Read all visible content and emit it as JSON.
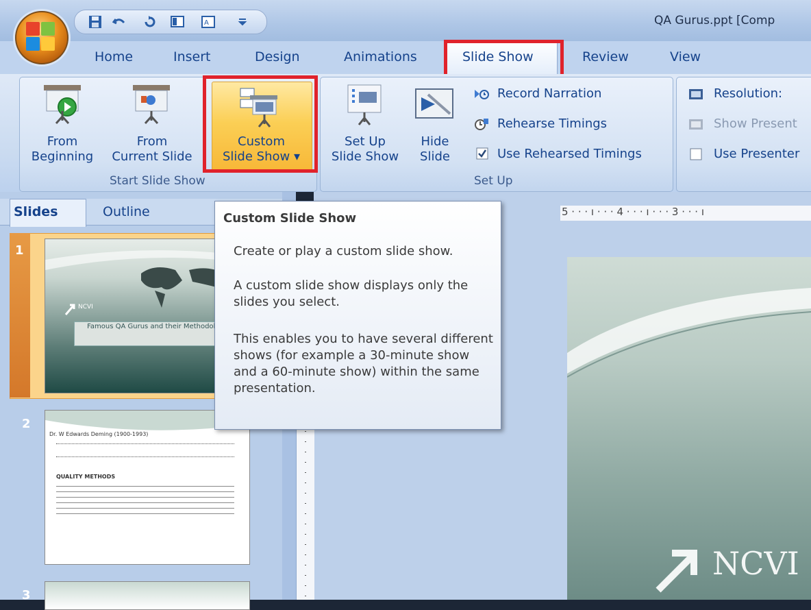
{
  "window": {
    "title": "QA Gurus.ppt [Comp"
  },
  "tabs": [
    {
      "label": "Home"
    },
    {
      "label": "Insert"
    },
    {
      "label": "Design"
    },
    {
      "label": "Animations"
    },
    {
      "label": "Slide Show"
    },
    {
      "label": "Review"
    },
    {
      "label": "View"
    }
  ],
  "ribbon": {
    "start_group": {
      "label": "Start Slide Show",
      "from_beginning": {
        "line1": "From",
        "line2": "Beginning"
      },
      "from_current": {
        "line1": "From",
        "line2": "Current Slide"
      },
      "custom_show": {
        "line1": "Custom",
        "line2": "Slide Show ▾"
      }
    },
    "setup_group": {
      "label": "Set Up",
      "setup_show": {
        "line1": "Set Up",
        "line2": "Slide Show"
      },
      "hide_slide": {
        "line1": "Hide",
        "line2": "Slide"
      },
      "record_narration": "Record Narration",
      "rehearse_timings": "Rehearse Timings",
      "use_rehearsed": "Use Rehearsed Timings"
    },
    "monitors_group": {
      "resolution": "Resolution:",
      "show_presentation_on": "Show Present",
      "use_presenter_view": "Use Presenter"
    }
  },
  "pane": {
    "tabs": [
      "Slides",
      "Outline"
    ],
    "slides": [
      {
        "number": "1",
        "title": "Famous QA Gurus and their Methodologies",
        "logo": "NCVI"
      },
      {
        "number": "2",
        "heading": "Dr. W Edwards Deming (1900-1993)",
        "subheading": "QUALITY METHODS"
      },
      {
        "number": "3"
      }
    ]
  },
  "ruler": {
    "text": "5 · · · ı · · · 4 · · · ı · · · 3 · · · ı"
  },
  "slide": {
    "logo_text": "NCVI"
  },
  "tooltip": {
    "title": "Custom Slide Show",
    "p1": "Create or play a custom slide show.",
    "p2": "A custom slide show displays only the slides you select.",
    "p3": "This enables you to have several different shows (for example a 30-minute show and a 60-minute show) within the same presentation."
  },
  "colors": {
    "highlight": "#e0222b",
    "ribbon_text": "#15428b",
    "selected_button": "#fbcf55"
  }
}
